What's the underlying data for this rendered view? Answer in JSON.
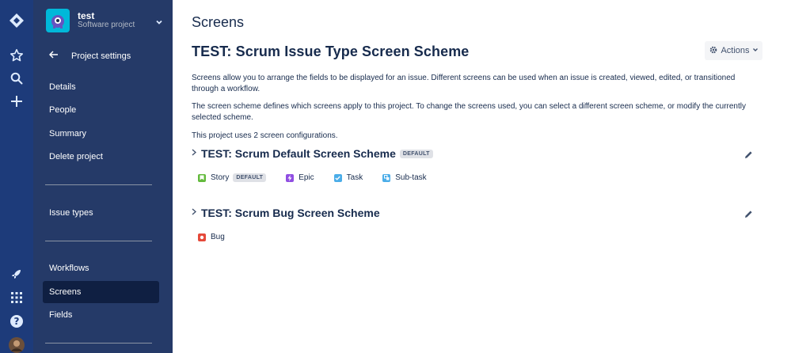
{
  "project": {
    "name": "test",
    "type": "Software project"
  },
  "sidebar": {
    "back_label": "Project settings",
    "items": [
      {
        "label": "Details"
      },
      {
        "label": "People"
      },
      {
        "label": "Summary"
      },
      {
        "label": "Delete project"
      },
      {
        "label": "Issue types"
      },
      {
        "label": "Workflows"
      },
      {
        "label": "Screens"
      },
      {
        "label": "Fields"
      }
    ]
  },
  "main": {
    "page_title": "Screens",
    "scheme_title": "TEST: Scrum Issue Type Screen Scheme",
    "actions_label": "Actions",
    "description_1": "Screens allow you to arrange the fields to be displayed for an issue. Different screens can be used when an issue is created, viewed, edited, or transitioned through a workflow.",
    "description_2": "The screen scheme defines which screens apply to this project. To change the screens used, you can select a different screen scheme, or modify the currently selected scheme.",
    "count_text": "This project uses 2 screen configurations.",
    "groups": [
      {
        "title": "TEST: Scrum Default Screen Scheme",
        "badge": "DEFAULT",
        "issue_types": [
          {
            "label": "Story",
            "badge": "DEFAULT",
            "color": "#63BA3C"
          },
          {
            "label": "Epic",
            "color": "#904EE2"
          },
          {
            "label": "Task",
            "color": "#4BADE8"
          },
          {
            "label": "Sub-task",
            "color": "#4BADE8"
          }
        ]
      },
      {
        "title": "TEST: Scrum Bug Screen Scheme",
        "issue_types": [
          {
            "label": "Bug",
            "color": "#E5493A"
          }
        ]
      }
    ]
  }
}
